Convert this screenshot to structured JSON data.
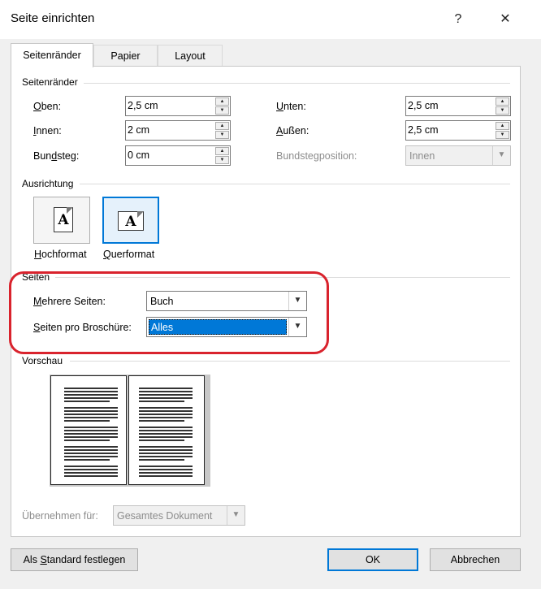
{
  "window": {
    "title": "Seite einrichten",
    "help_glyph": "?",
    "close_glyph": "✕"
  },
  "tabs": [
    {
      "label": "Seitenränder",
      "active": true
    },
    {
      "label": "Papier",
      "active": false
    },
    {
      "label": "Layout",
      "active": false
    }
  ],
  "margins": {
    "section_label": "Seitenränder",
    "oben": {
      "label": "Oben:",
      "value": "2,5 cm"
    },
    "unten": {
      "label": "Unten:",
      "value": "2,5 cm"
    },
    "innen": {
      "label": "Innen:",
      "value": "2 cm"
    },
    "aussen": {
      "label": "Außen:",
      "value": "2,5 cm"
    },
    "bundsteg": {
      "label": "Bundsteg:",
      "value": "0 cm"
    },
    "bundstegposition": {
      "label": "Bundstegposition:",
      "value": "Innen"
    }
  },
  "orientation": {
    "section_label": "Ausrichtung",
    "portrait_label": "Hochformat",
    "landscape_label": "Querformat",
    "icon_letter": "A",
    "selected": "Querformat"
  },
  "pages": {
    "section_label": "Seiten",
    "mehrere_seiten": {
      "label": "Mehrere Seiten:",
      "value": "Buch"
    },
    "seiten_pro_broschuere": {
      "label": "Seiten pro Broschüre:",
      "value": "Alles"
    }
  },
  "preview": {
    "section_label": "Vorschau"
  },
  "apply": {
    "label": "Übernehmen für:",
    "value": "Gesamtes Dokument"
  },
  "buttons": {
    "default": "Als Standard festlegen",
    "ok": "OK",
    "cancel": "Abbrechen"
  },
  "colors": {
    "accent": "#0078d7",
    "highlight_ring": "#d9232d"
  }
}
